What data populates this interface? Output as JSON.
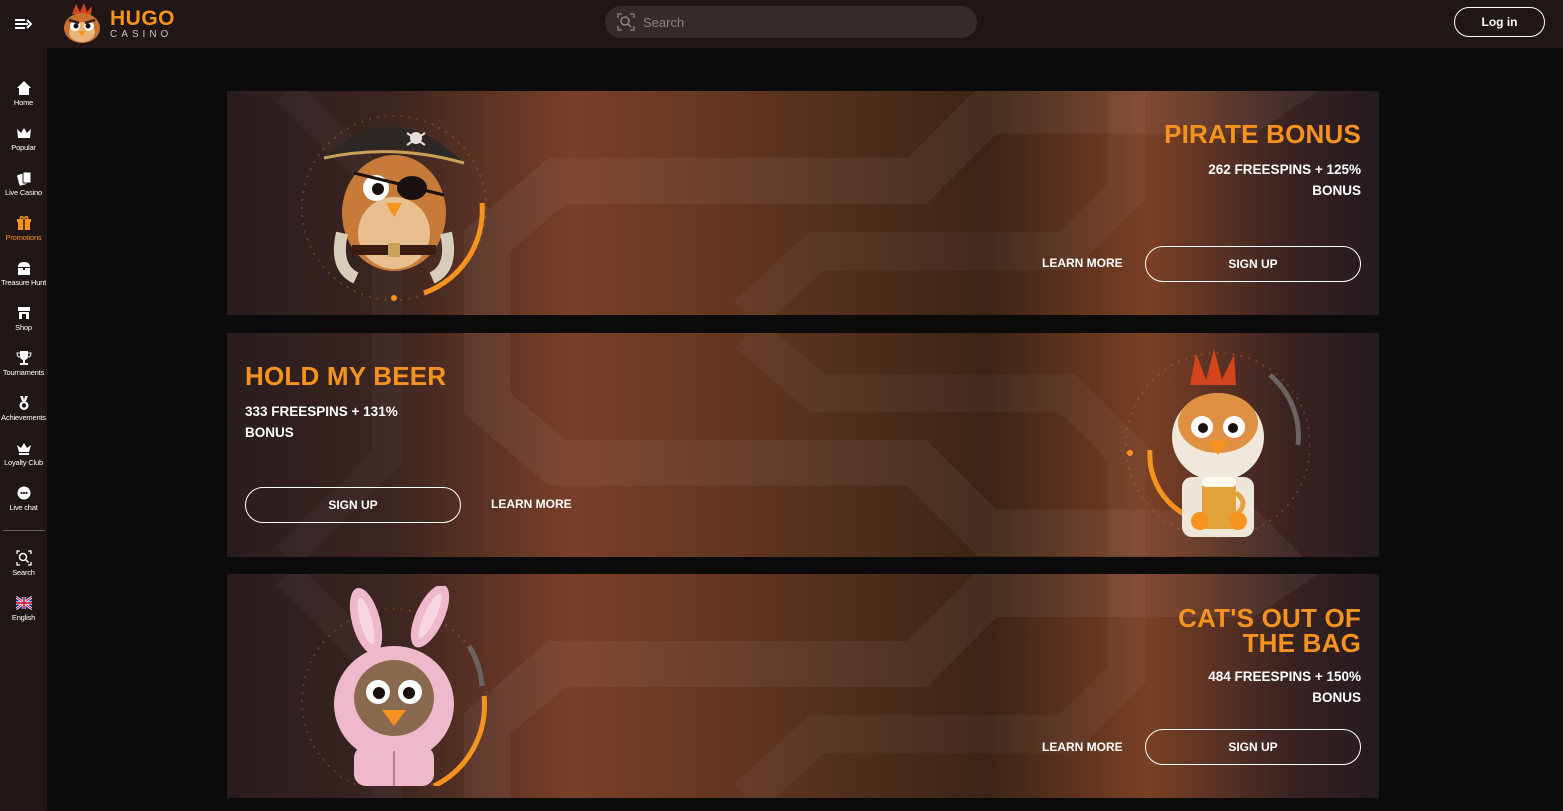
{
  "header": {
    "logo_primary": "HUGO",
    "logo_secondary": "CASINO",
    "search_placeholder": "Search",
    "login_label": "Log in"
  },
  "sidebar": {
    "items": [
      {
        "label": "Home",
        "icon": "home-icon"
      },
      {
        "label": "Popular",
        "icon": "crown-icon"
      },
      {
        "label": "Live Casino",
        "icon": "cards-icon"
      },
      {
        "label": "Promotions",
        "icon": "gift-icon",
        "active": true
      },
      {
        "label": "Treasure Hunt",
        "icon": "treasure-chest-icon"
      },
      {
        "label": "Shop",
        "icon": "shop-icon"
      },
      {
        "label": "Tournaments",
        "icon": "trophy-icon"
      },
      {
        "label": "Achievements",
        "icon": "medal-icon"
      },
      {
        "label": "Loyalty Club",
        "icon": "crown-icon"
      },
      {
        "label": "Live chat",
        "icon": "chat-icon"
      },
      {
        "label": "Search",
        "icon": "search-icon"
      },
      {
        "label": "English",
        "icon": "uk-flag-icon"
      }
    ]
  },
  "promotions": [
    {
      "title_line1": "PIRATE BONUS",
      "title_line2": "",
      "desc_line1": "262 FREESPINS + 125%",
      "desc_line2": "BONUS",
      "learn_more": "LEARN MORE",
      "sign_up": "SIGN UP",
      "mascot": "pirate-owl-mascot"
    },
    {
      "title_line1": "HOLD MY BEER",
      "title_line2": "",
      "desc_line1": "333 FREESPINS + 131%",
      "desc_line2": "BONUS",
      "learn_more": "LEARN MORE",
      "sign_up": "SIGN UP",
      "mascot": "beer-chick-mascot"
    },
    {
      "title_line1": "CAT'S OUT OF",
      "title_line2": "THE BAG",
      "desc_line1": "484 FREESPINS + 150%",
      "desc_line2": "BONUS",
      "learn_more": "LEARN MORE",
      "sign_up": "SIGN UP",
      "mascot": "bunny-costume-owl-mascot"
    }
  ],
  "colors": {
    "accent": "#f6931e",
    "topbar_bg": "#201615",
    "page_bg": "#0c0b0b"
  }
}
